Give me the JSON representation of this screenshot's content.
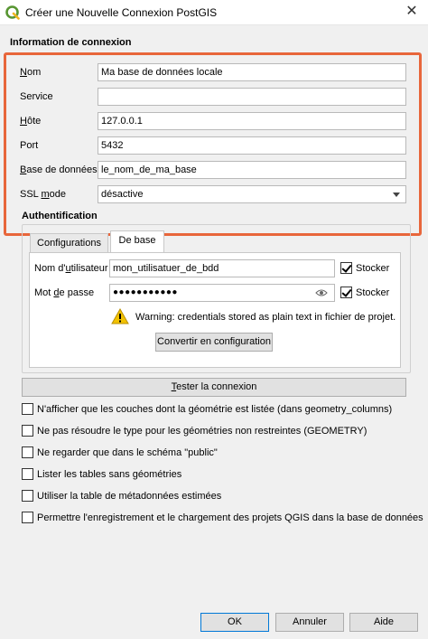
{
  "window": {
    "title": "Créer une Nouvelle Connexion PostGIS",
    "close": "✕"
  },
  "connection": {
    "group_title": "Information de connexion",
    "fields": [
      {
        "key": "name",
        "label": "Nom",
        "underline": "N",
        "rest": "om",
        "value": "Ma base de données locale"
      },
      {
        "key": "service",
        "label": "Service",
        "underline": "",
        "rest": "Service",
        "value": ""
      },
      {
        "key": "host",
        "label": "Hôte",
        "underline": "H",
        "rest": "ôte",
        "value": "127.0.0.1"
      },
      {
        "key": "port",
        "label": "Port",
        "underline": "",
        "rest": "Port",
        "value": "5432"
      },
      {
        "key": "database",
        "label": "Base de données",
        "underline": "B",
        "rest": "ase de données",
        "value": "le_nom_de_ma_base"
      }
    ],
    "ssl": {
      "label_pre": "SSL ",
      "label_u": "m",
      "label_post": "ode",
      "value": "désactive"
    }
  },
  "auth": {
    "group_title": "Authentification",
    "tabs": [
      "Configurations",
      "De base"
    ],
    "username": {
      "label_pre": "Nom d'",
      "label_u": "u",
      "label_post": "tilisateur",
      "value": "mon_utilisatuer_de_bdd",
      "store_label": "Stocker",
      "store_checked": true
    },
    "password": {
      "label_pre": "Mot ",
      "label_u": "d",
      "label_post": "e passe",
      "value": "●●●●●●●●●●●",
      "store_label": "Stocker",
      "store_checked": true
    },
    "warning": "Warning: credentials stored as plain text in fichier de projet.",
    "convert_button": "Convertir en configuration"
  },
  "test_button": {
    "pre": "",
    "u": "T",
    "post": "ester la connexion"
  },
  "options": [
    {
      "label": "N'afficher que les couches dont la géométrie est listée (dans geometry_columns)",
      "checked": false
    },
    {
      "label": "Ne pas résoudre le type pour les géométries non restreintes (GEOMETRY)",
      "checked": false
    },
    {
      "label": "Ne regarder que dans le schéma \"public\"",
      "checked": false
    },
    {
      "label": "Lister les tables sans géométries",
      "checked": false
    },
    {
      "label": "Utiliser la table de métadonnées estimées",
      "checked": false
    },
    {
      "label": "Permettre l'enregistrement et le chargement des projets QGIS dans la base de données",
      "checked": false
    }
  ],
  "footer": {
    "ok": "OK",
    "cancel": "Annuler",
    "help": "Aide"
  },
  "colors": {
    "highlight": "#e8663b",
    "qgis_green": "#589632",
    "warning": "#f2c200"
  }
}
